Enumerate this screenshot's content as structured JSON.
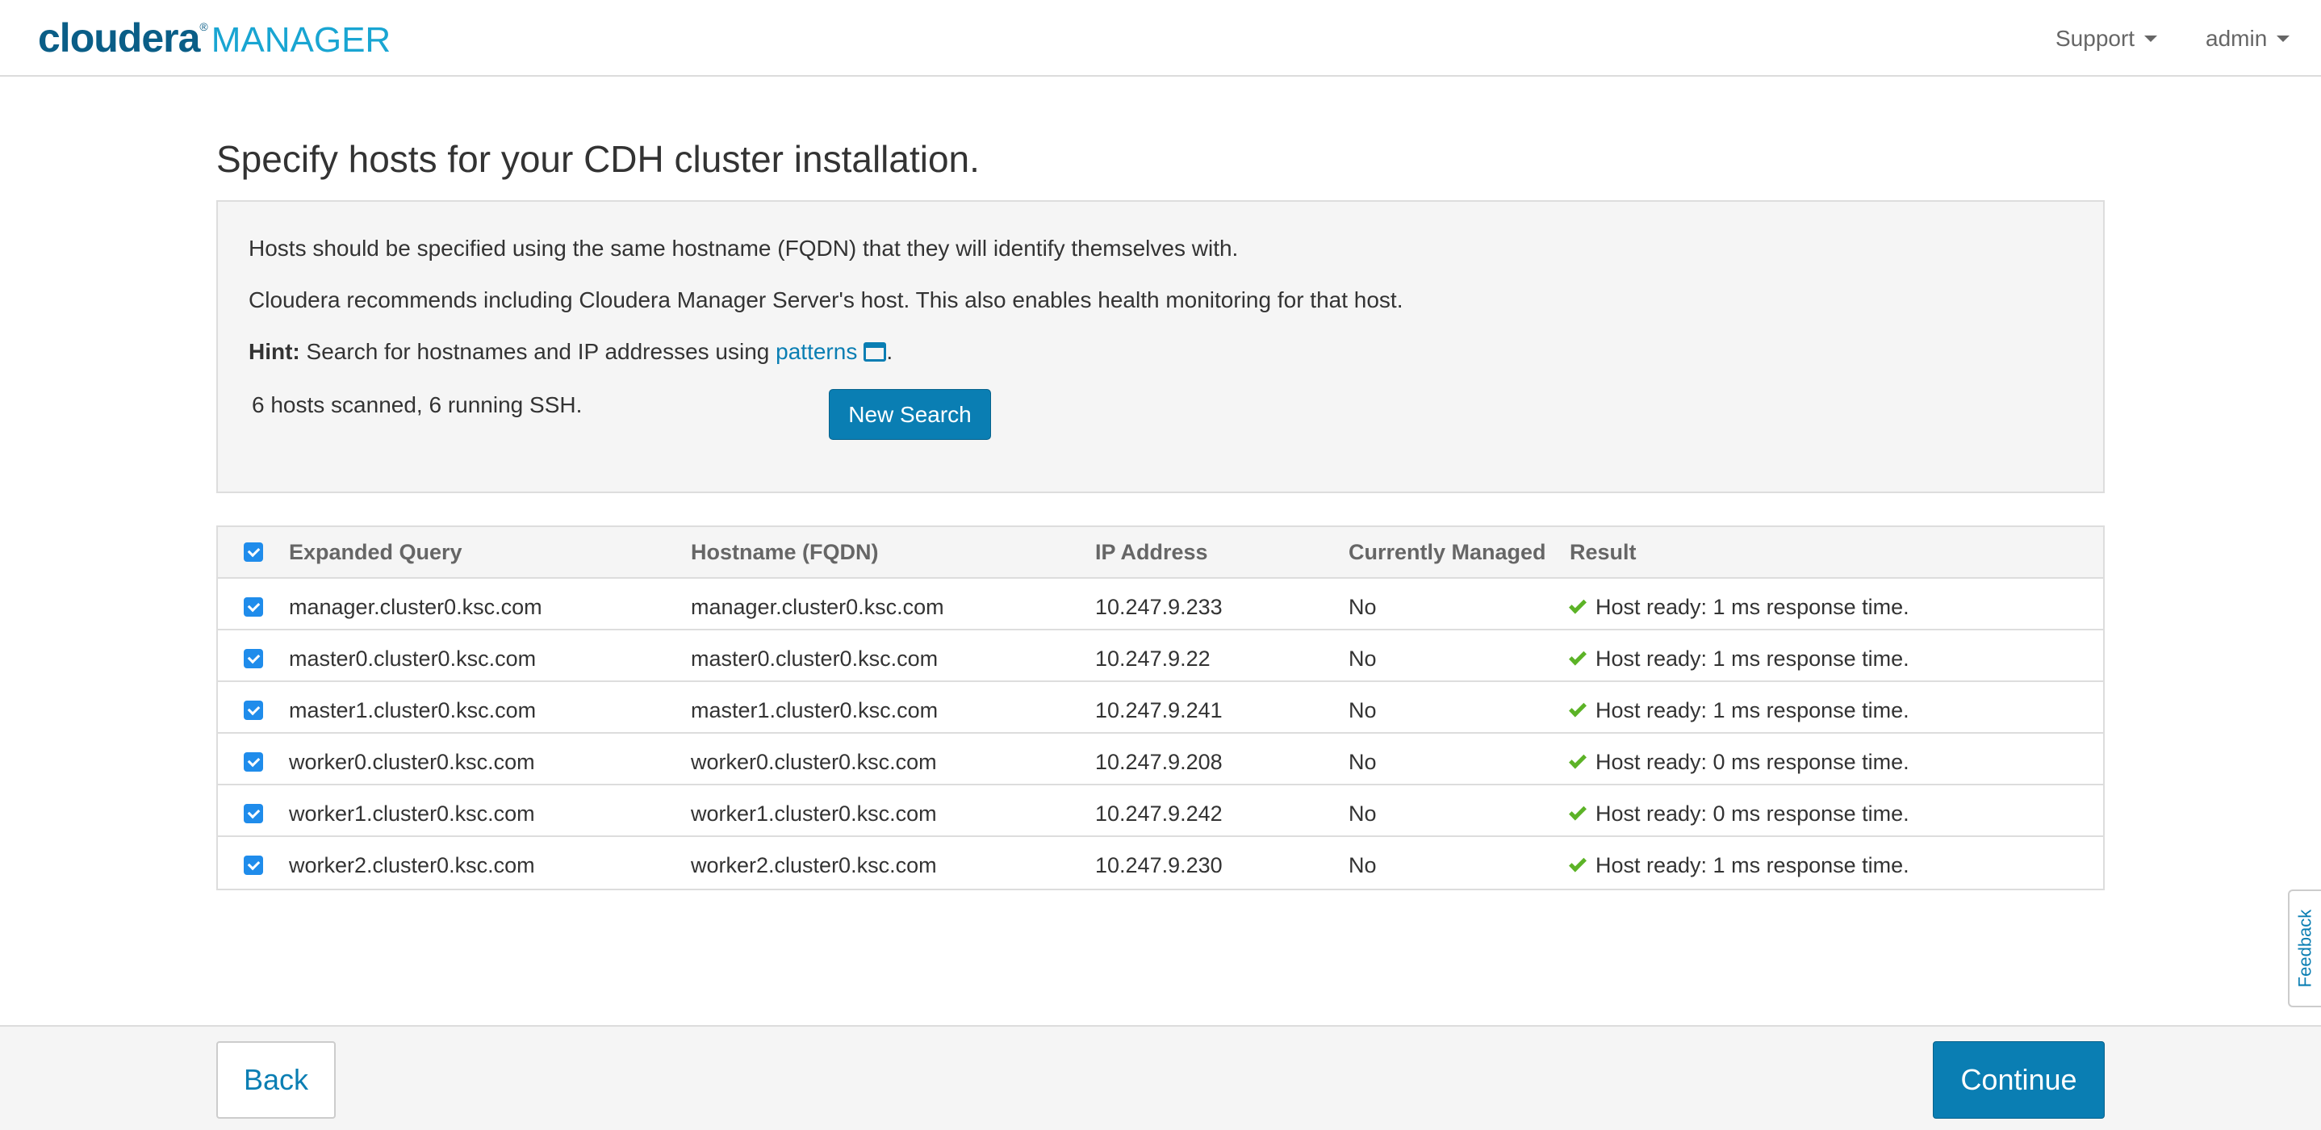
{
  "header": {
    "logo_brand": "cloudera",
    "logo_product": "MANAGER",
    "menus": {
      "support": "Support",
      "admin": "admin"
    }
  },
  "page": {
    "title": "Specify hosts for your CDH cluster installation."
  },
  "info": {
    "line1": "Hosts should be specified using the same hostname (FQDN) that they will identify themselves with.",
    "line2": "Cloudera recommends including Cloudera Manager Server's host. This also enables health monitoring for that host.",
    "hint_label": "Hint:",
    "hint_text": " Search for hostnames and IP addresses using ",
    "hint_link": "patterns",
    "hint_end": ".",
    "scan_status": "6 hosts scanned, 6 running SSH.",
    "new_search_label": "New Search"
  },
  "table": {
    "headers": {
      "query": "Expanded Query",
      "hostname": "Hostname (FQDN)",
      "ip": "IP Address",
      "managed": "Currently Managed",
      "result": "Result"
    },
    "select_all_checked": true,
    "rows": [
      {
        "query": "manager.cluster0.ksc.com",
        "hostname": "manager.cluster0.ksc.com",
        "ip": "10.247.9.233",
        "managed": "No",
        "result": "Host ready: 1 ms response time.",
        "checked": true
      },
      {
        "query": "master0.cluster0.ksc.com",
        "hostname": "master0.cluster0.ksc.com",
        "ip": "10.247.9.22",
        "managed": "No",
        "result": "Host ready: 1 ms response time.",
        "checked": true
      },
      {
        "query": "master1.cluster0.ksc.com",
        "hostname": "master1.cluster0.ksc.com",
        "ip": "10.247.9.241",
        "managed": "No",
        "result": "Host ready: 1 ms response time.",
        "checked": true
      },
      {
        "query": "worker0.cluster0.ksc.com",
        "hostname": "worker0.cluster0.ksc.com",
        "ip": "10.247.9.208",
        "managed": "No",
        "result": "Host ready: 0 ms response time.",
        "checked": true
      },
      {
        "query": "worker1.cluster0.ksc.com",
        "hostname": "worker1.cluster0.ksc.com",
        "ip": "10.247.9.242",
        "managed": "No",
        "result": "Host ready: 0 ms response time.",
        "checked": true
      },
      {
        "query": "worker2.cluster0.ksc.com",
        "hostname": "worker2.cluster0.ksc.com",
        "ip": "10.247.9.230",
        "managed": "No",
        "result": "Host ready: 1 ms response time.",
        "checked": true
      }
    ]
  },
  "footer": {
    "back_label": "Back",
    "continue_label": "Continue"
  },
  "feedback": {
    "label": "Feedback"
  },
  "colors": {
    "brand_dark": "#0a5e87",
    "brand_light": "#19a5d2",
    "primary_button": "#0a7eb3",
    "checkbox": "#1f8ceb",
    "success": "#5cb327"
  }
}
